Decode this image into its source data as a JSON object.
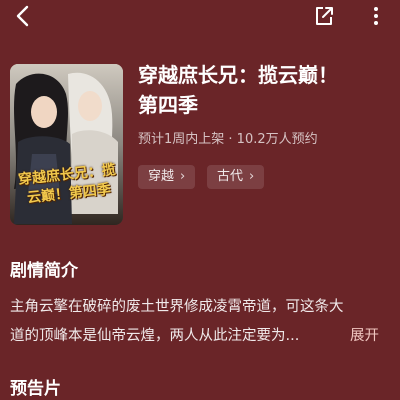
{
  "header": {
    "back_icon": "chevron-left-icon",
    "share_icon": "share-icon",
    "more_icon": "more-vertical-icon"
  },
  "book": {
    "cover_text": "穿越庶长兄：揽云巅！第四季",
    "title_line1": "穿越庶长兄：揽云巅！",
    "title_line2": "第四季",
    "meta": "预计1周内上架 · 10.2万人预约",
    "tags": [
      {
        "label": "穿越"
      },
      {
        "label": "古代"
      }
    ]
  },
  "synopsis": {
    "heading": "剧情简介",
    "line1": "主角云擎在破碎的废土世界修成凌霄帝道，可这条大",
    "line2": "道的顶峰本是仙帝云煌，两人从此注定要为...",
    "expand_label": "展开"
  },
  "trailer": {
    "heading": "预告片"
  },
  "colors": {
    "background": "#6a2528",
    "cover_title": "#f1c84c"
  }
}
